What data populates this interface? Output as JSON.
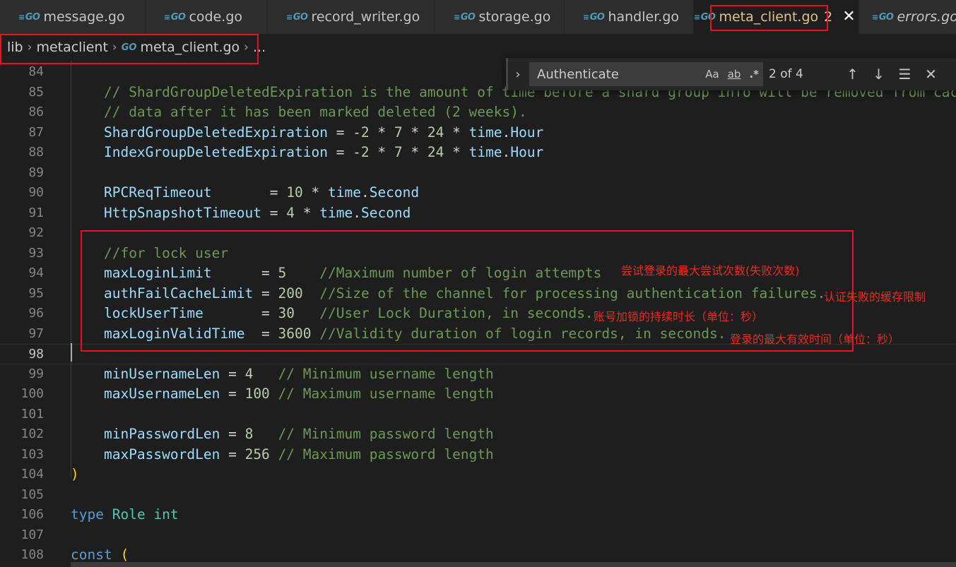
{
  "tabs": [
    {
      "label": "message.go",
      "icon": "go-file-icon"
    },
    {
      "label": "code.go",
      "icon": "go-file-icon"
    },
    {
      "label": "record_writer.go",
      "icon": "go-file-icon"
    },
    {
      "label": "storage.go",
      "icon": "go-file-icon"
    },
    {
      "label": "handler.go",
      "icon": "go-file-icon"
    },
    {
      "label": "meta_client.go",
      "icon": "go-file-icon",
      "badge": "2",
      "active": true
    },
    {
      "label": "errors.go",
      "icon": "go-file-icon"
    }
  ],
  "go_icon_text": "GO",
  "close_glyph": "✕",
  "breadcrumb": {
    "items": [
      "lib",
      "metaclient",
      "meta_client.go",
      "..."
    ]
  },
  "find": {
    "query": "Authenticate",
    "match_case": "Aa",
    "whole_word": "ab",
    "regex": ".*",
    "count": "2 of 4"
  },
  "code_lines": [
    {
      "n": "84",
      "segs": []
    },
    {
      "n": "85",
      "segs": [
        {
          "t": "    "
        },
        {
          "t": "// ShardGroupDeletedExpiration is the amount of time before a shard group info will be removed from cache",
          "c": "t-com"
        }
      ]
    },
    {
      "n": "86",
      "segs": [
        {
          "t": "    "
        },
        {
          "t": "// data after it has been marked deleted (2 weeks).",
          "c": "t-com"
        }
      ]
    },
    {
      "n": "87",
      "segs": [
        {
          "t": "    "
        },
        {
          "t": "ShardGroupDeletedExpiration",
          "c": "t-var"
        },
        {
          "t": " = -"
        },
        {
          "t": "2",
          "c": "t-num"
        },
        {
          "t": " * "
        },
        {
          "t": "7",
          "c": "t-num"
        },
        {
          "t": " * "
        },
        {
          "t": "24",
          "c": "t-num"
        },
        {
          "t": " * "
        },
        {
          "t": "time",
          "c": "t-var"
        },
        {
          "t": "."
        },
        {
          "t": "Hour",
          "c": "t-var"
        }
      ]
    },
    {
      "n": "88",
      "segs": [
        {
          "t": "    "
        },
        {
          "t": "IndexGroupDeletedExpiration",
          "c": "t-var"
        },
        {
          "t": " = -"
        },
        {
          "t": "2",
          "c": "t-num"
        },
        {
          "t": " * "
        },
        {
          "t": "7",
          "c": "t-num"
        },
        {
          "t": " * "
        },
        {
          "t": "24",
          "c": "t-num"
        },
        {
          "t": " * "
        },
        {
          "t": "time",
          "c": "t-var"
        },
        {
          "t": "."
        },
        {
          "t": "Hour",
          "c": "t-var"
        }
      ]
    },
    {
      "n": "89",
      "segs": []
    },
    {
      "n": "90",
      "segs": [
        {
          "t": "    "
        },
        {
          "t": "RPCReqTimeout",
          "c": "t-var"
        },
        {
          "t": "       = "
        },
        {
          "t": "10",
          "c": "t-num"
        },
        {
          "t": " * "
        },
        {
          "t": "time",
          "c": "t-var"
        },
        {
          "t": "."
        },
        {
          "t": "Second",
          "c": "t-var"
        }
      ]
    },
    {
      "n": "91",
      "segs": [
        {
          "t": "    "
        },
        {
          "t": "HttpSnapshotTimeout",
          "c": "t-var"
        },
        {
          "t": " = "
        },
        {
          "t": "4",
          "c": "t-num"
        },
        {
          "t": " * "
        },
        {
          "t": "time",
          "c": "t-var"
        },
        {
          "t": "."
        },
        {
          "t": "Second",
          "c": "t-var"
        }
      ]
    },
    {
      "n": "92",
      "segs": []
    },
    {
      "n": "93",
      "segs": [
        {
          "t": "    "
        },
        {
          "t": "//for lock user",
          "c": "t-com"
        }
      ]
    },
    {
      "n": "94",
      "segs": [
        {
          "t": "    "
        },
        {
          "t": "maxLoginLimit",
          "c": "t-var"
        },
        {
          "t": "      = "
        },
        {
          "t": "5",
          "c": "t-num"
        },
        {
          "t": "    "
        },
        {
          "t": "//Maximum number of login attempts",
          "c": "t-com"
        }
      ]
    },
    {
      "n": "95",
      "segs": [
        {
          "t": "    "
        },
        {
          "t": "authFailCacheLimit",
          "c": "t-var"
        },
        {
          "t": " = "
        },
        {
          "t": "200",
          "c": "t-num"
        },
        {
          "t": "  "
        },
        {
          "t": "//Size of the channel for processing authentication failures.",
          "c": "t-com"
        }
      ]
    },
    {
      "n": "96",
      "segs": [
        {
          "t": "    "
        },
        {
          "t": "lockUserTime",
          "c": "t-var"
        },
        {
          "t": "       = "
        },
        {
          "t": "30",
          "c": "t-num"
        },
        {
          "t": "   "
        },
        {
          "t": "//User Lock Duration, in seconds.",
          "c": "t-com"
        }
      ]
    },
    {
      "n": "97",
      "segs": [
        {
          "t": "    "
        },
        {
          "t": "maxLoginValidTime",
          "c": "t-var"
        },
        {
          "t": "  = "
        },
        {
          "t": "3600",
          "c": "t-num"
        },
        {
          "t": " "
        },
        {
          "t": "//Validity duration of login records, in seconds.",
          "c": "t-com"
        }
      ]
    },
    {
      "n": "98",
      "segs": [],
      "current": true
    },
    {
      "n": "99",
      "segs": [
        {
          "t": "    "
        },
        {
          "t": "minUsernameLen",
          "c": "t-var"
        },
        {
          "t": " = "
        },
        {
          "t": "4",
          "c": "t-num"
        },
        {
          "t": "   "
        },
        {
          "t": "// Minimum username length",
          "c": "t-com"
        }
      ]
    },
    {
      "n": "100",
      "segs": [
        {
          "t": "    "
        },
        {
          "t": "maxUsernameLen",
          "c": "t-var"
        },
        {
          "t": " = "
        },
        {
          "t": "100",
          "c": "t-num"
        },
        {
          "t": " "
        },
        {
          "t": "// Maximum username length",
          "c": "t-com"
        }
      ]
    },
    {
      "n": "101",
      "segs": []
    },
    {
      "n": "102",
      "segs": [
        {
          "t": "    "
        },
        {
          "t": "minPasswordLen",
          "c": "t-var"
        },
        {
          "t": " = "
        },
        {
          "t": "8",
          "c": "t-num"
        },
        {
          "t": "   "
        },
        {
          "t": "// Minimum password length",
          "c": "t-com"
        }
      ]
    },
    {
      "n": "103",
      "segs": [
        {
          "t": "    "
        },
        {
          "t": "maxPasswordLen",
          "c": "t-var"
        },
        {
          "t": " = "
        },
        {
          "t": "256",
          "c": "t-num"
        },
        {
          "t": " "
        },
        {
          "t": "// Maximum password length",
          "c": "t-com"
        }
      ]
    },
    {
      "n": "104",
      "segs": [
        {
          "t": ")",
          "c": "t-paren"
        }
      ]
    },
    {
      "n": "105",
      "segs": []
    },
    {
      "n": "106",
      "segs": [
        {
          "t": "type",
          "c": "t-kw"
        },
        {
          "t": " "
        },
        {
          "t": "Role",
          "c": "t-type"
        },
        {
          "t": " "
        },
        {
          "t": "int",
          "c": "t-type"
        }
      ]
    },
    {
      "n": "107",
      "segs": []
    },
    {
      "n": "108",
      "segs": [
        {
          "t": "const",
          "c": "t-kw"
        },
        {
          "t": " "
        },
        {
          "t": "(",
          "c": "t-paren"
        }
      ]
    }
  ],
  "annotations": [
    "尝试登录的最大尝试次数(失败次数)",
    "认证失败的缓存限制",
    "账号加锁的持续时长（单位：秒）",
    "登录的最大有效时间（单位：秒）"
  ],
  "colors": {
    "annotation_red": "#e81123",
    "comment_green": "#6a9955",
    "variable_blue": "#9cdcfe",
    "number_green": "#b5cea8",
    "keyword_blue": "#569cd6",
    "type_teal": "#4ec9b0"
  }
}
